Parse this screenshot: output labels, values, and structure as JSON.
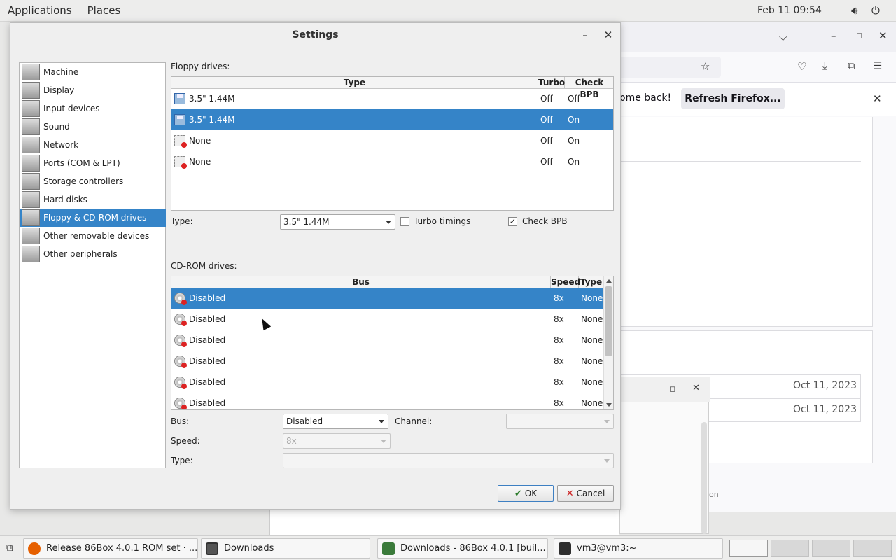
{
  "topbar": {
    "applications": "Applications",
    "places": "Places",
    "clock": "Feb 11  09:54"
  },
  "firefox": {
    "notif_text": "ome back!",
    "refresh_label": "Refresh Firefox...",
    "dates": [
      "Oct 11, 2023",
      "Oct 11, 2023"
    ],
    "partial_text": "on"
  },
  "dialog": {
    "title": "Settings",
    "categories": [
      {
        "label": "Machine"
      },
      {
        "label": "Display"
      },
      {
        "label": "Input devices"
      },
      {
        "label": "Sound"
      },
      {
        "label": "Network"
      },
      {
        "label": "Ports (COM & LPT)"
      },
      {
        "label": "Storage controllers"
      },
      {
        "label": "Hard disks"
      },
      {
        "label": "Floppy & CD-ROM drives"
      },
      {
        "label": "Other removable devices"
      },
      {
        "label": "Other peripherals"
      }
    ],
    "selected_category": "Floppy & CD-ROM drives",
    "floppy": {
      "section_label": "Floppy drives:",
      "columns": [
        "Type",
        "Turbo",
        "Check BPB"
      ],
      "rows": [
        {
          "type": "3.5\" 1.44M",
          "turbo": "Off",
          "bpb": "Off"
        },
        {
          "type": "3.5\" 1.44M",
          "turbo": "Off",
          "bpb": "On"
        },
        {
          "type": "None",
          "turbo": "Off",
          "bpb": "On"
        },
        {
          "type": "None",
          "turbo": "Off",
          "bpb": "On"
        }
      ],
      "selected_row": 1,
      "type_label": "Type:",
      "type_value": "3.5\" 1.44M",
      "turbo_label": "Turbo timings",
      "turbo_checked": false,
      "bpb_label": "Check BPB",
      "bpb_checked": true
    },
    "cdrom": {
      "section_label": "CD-ROM drives:",
      "columns": [
        "Bus",
        "Speed",
        "Type"
      ],
      "rows": [
        {
          "bus": "Disabled",
          "speed": "8x",
          "type": "None"
        },
        {
          "bus": "Disabled",
          "speed": "8x",
          "type": "None"
        },
        {
          "bus": "Disabled",
          "speed": "8x",
          "type": "None"
        },
        {
          "bus": "Disabled",
          "speed": "8x",
          "type": "None"
        },
        {
          "bus": "Disabled",
          "speed": "8x",
          "type": "None"
        },
        {
          "bus": "Disabled",
          "speed": "8x",
          "type": "None"
        }
      ],
      "selected_row": 0,
      "bus_label": "Bus:",
      "bus_value": "Disabled",
      "channel_label": "Channel:",
      "channel_value": "",
      "speed_label": "Speed:",
      "speed_value": "8x",
      "type_label": "Type:",
      "type_value": ""
    },
    "ok_label": "OK",
    "cancel_label": "Cancel"
  },
  "taskbar": {
    "tasks": [
      {
        "label": "Release 86Box 4.0.1 ROM set · ...",
        "icon": "firefox-icon"
      },
      {
        "label": "Downloads",
        "icon": "files-icon"
      },
      {
        "label": "Downloads - 86Box 4.0.1 [buil...",
        "icon": "86box-icon"
      },
      {
        "label": "vm3@vm3:~",
        "icon": "terminal-icon"
      }
    ]
  },
  "colors": {
    "selection": "#3584c8",
    "firefox_icon": "#e66000",
    "box_icon": "#3a7a3a",
    "terminal_icon": "#2e2e2e"
  }
}
